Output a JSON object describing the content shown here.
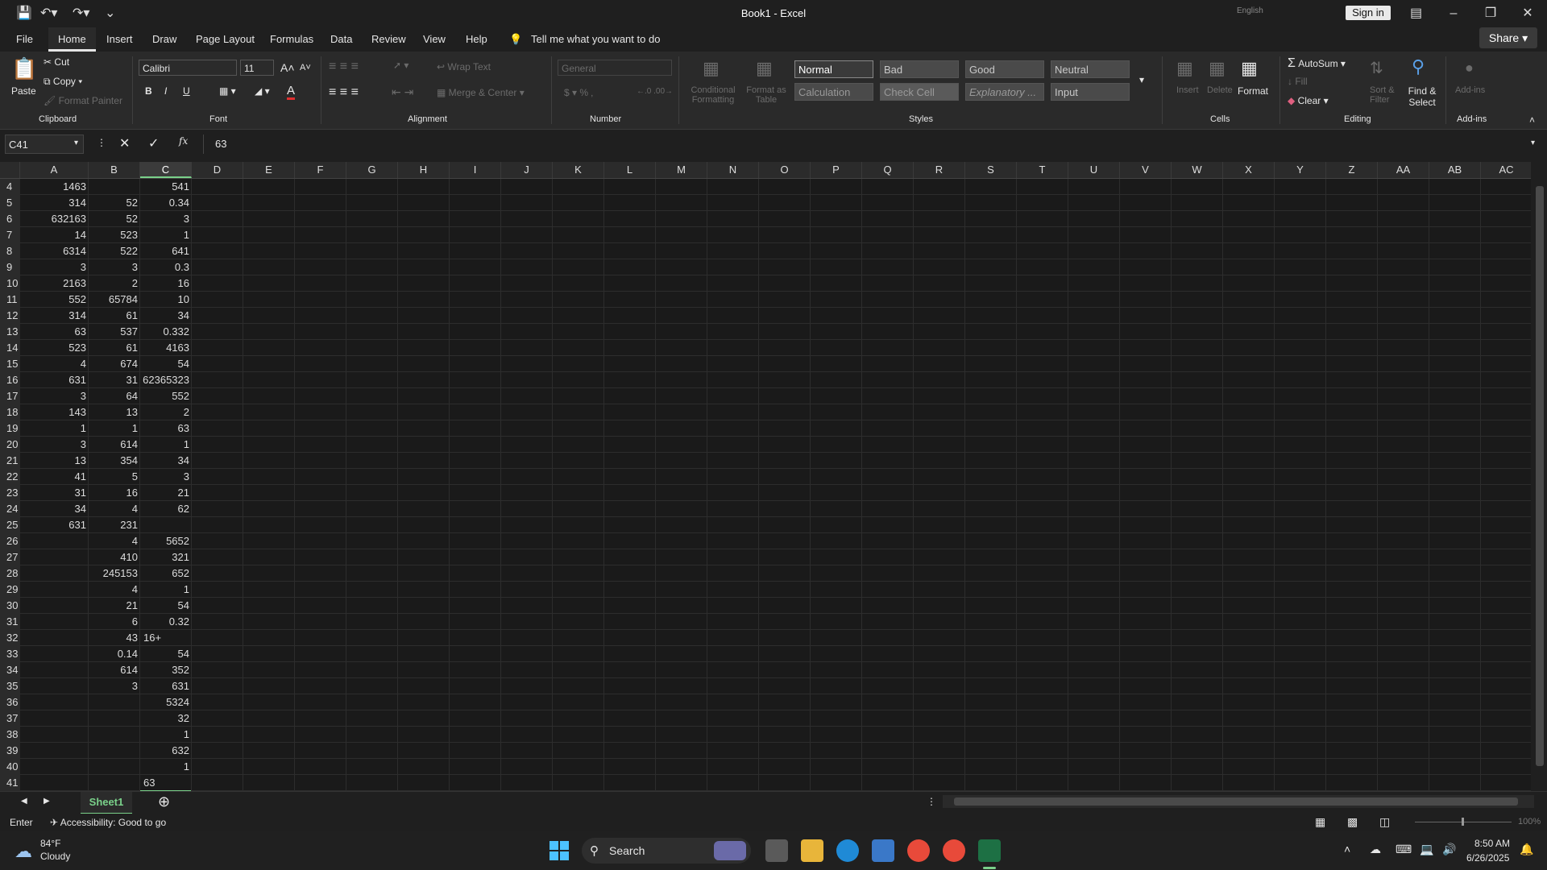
{
  "titlebar": {
    "title": "Book1  -  Excel",
    "signin": "Sign in",
    "language": "English"
  },
  "tabs": [
    "File",
    "Home",
    "Insert",
    "Draw",
    "Page Layout",
    "Formulas",
    "Data",
    "Review",
    "View",
    "Help"
  ],
  "tell_me": "Tell me what you want to do",
  "share": "Share",
  "ribbon": {
    "clipboard": {
      "paste": "Paste",
      "cut": "Cut",
      "copy": "Copy",
      "format_painter": "Format Painter",
      "label": "Clipboard"
    },
    "font": {
      "name": "Calibri",
      "size": "11",
      "bold": "B",
      "italic": "I",
      "underline": "U",
      "label": "Font"
    },
    "alignment": {
      "wrap": "Wrap Text",
      "merge": "Merge & Center",
      "label": "Alignment"
    },
    "number": {
      "format": "General",
      "label": "Number"
    },
    "styles": {
      "conditional": "Conditional Formatting",
      "format_as_table": "Format as Table",
      "cells": [
        "Normal",
        "Bad",
        "Good",
        "Neutral",
        "Calculation",
        "Check Cell",
        "Explanatory ...",
        "Input"
      ],
      "label": "Styles"
    },
    "cells": {
      "insert": "Insert",
      "delete": "Delete",
      "format": "Format",
      "label": "Cells"
    },
    "editing": {
      "autosum": "AutoSum",
      "fill": "Fill",
      "clear": "Clear",
      "sort": "Sort & Filter",
      "find": "Find & Select",
      "label": "Editing"
    },
    "addins": {
      "label": "Add-ins",
      "button": "Add-ins"
    }
  },
  "formula_bar": {
    "name_box": "C41",
    "value": "63"
  },
  "columns": [
    "A",
    "B",
    "C",
    "D",
    "E",
    "F",
    "G",
    "H",
    "I",
    "J",
    "K",
    "L",
    "M",
    "N",
    "O",
    "P",
    "Q",
    "R",
    "S",
    "T",
    "U",
    "V",
    "W",
    "X",
    "Y",
    "Z",
    "AA",
    "AB",
    "AC"
  ],
  "rows": [
    {
      "n": "4",
      "a": "1463",
      "b": "",
      "c": "541"
    },
    {
      "n": "5",
      "a": "314",
      "b": "52",
      "c": "0.34"
    },
    {
      "n": "6",
      "a": "632163",
      "b": "52",
      "c": "3"
    },
    {
      "n": "7",
      "a": "14",
      "b": "523",
      "c": "1"
    },
    {
      "n": "8",
      "a": "6314",
      "b": "522",
      "c": "641"
    },
    {
      "n": "9",
      "a": "3",
      "b": "3",
      "c": "0.3"
    },
    {
      "n": "10",
      "a": "2163",
      "b": "2",
      "c": "16"
    },
    {
      "n": "11",
      "a": "552",
      "b": "65784",
      "c": "10"
    },
    {
      "n": "12",
      "a": "314",
      "b": "61",
      "c": "34"
    },
    {
      "n": "13",
      "a": "63",
      "b": "537",
      "c": "0.332"
    },
    {
      "n": "14",
      "a": "523",
      "b": "61",
      "c": "4163"
    },
    {
      "n": "15",
      "a": "4",
      "b": "674",
      "c": "54"
    },
    {
      "n": "16",
      "a": "631",
      "b": "31",
      "c": "62365323"
    },
    {
      "n": "17",
      "a": "3",
      "b": "64",
      "c": "552"
    },
    {
      "n": "18",
      "a": "143",
      "b": "13",
      "c": "2"
    },
    {
      "n": "19",
      "a": "1",
      "b": "1",
      "c": "63"
    },
    {
      "n": "20",
      "a": "3",
      "b": "614",
      "c": "1"
    },
    {
      "n": "21",
      "a": "13",
      "b": "354",
      "c": "34"
    },
    {
      "n": "22",
      "a": "41",
      "b": "5",
      "c": "3"
    },
    {
      "n": "23",
      "a": "31",
      "b": "16",
      "c": "21"
    },
    {
      "n": "24",
      "a": "34",
      "b": "4",
      "c": "62"
    },
    {
      "n": "25",
      "a": "631",
      "b": "231",
      "c": ""
    },
    {
      "n": "26",
      "a": "",
      "b": "4",
      "c": "5652"
    },
    {
      "n": "27",
      "a": "",
      "b": "410",
      "c": "321"
    },
    {
      "n": "28",
      "a": "",
      "b": "245153",
      "c": "652"
    },
    {
      "n": "29",
      "a": "",
      "b": "4",
      "c": "1"
    },
    {
      "n": "30",
      "a": "",
      "b": "21",
      "c": "54"
    },
    {
      "n": "31",
      "a": "",
      "b": "6",
      "c": "0.32"
    },
    {
      "n": "32",
      "a": "",
      "b": "43",
      "c": "16+"
    },
    {
      "n": "33",
      "a": "",
      "b": "0.14",
      "c": "54"
    },
    {
      "n": "34",
      "a": "",
      "b": "614",
      "c": "352"
    },
    {
      "n": "35",
      "a": "",
      "b": "3",
      "c": "631"
    },
    {
      "n": "36",
      "a": "",
      "b": "",
      "c": "5324"
    },
    {
      "n": "37",
      "a": "",
      "b": "",
      "c": "32"
    },
    {
      "n": "38",
      "a": "",
      "b": "",
      "c": "1"
    },
    {
      "n": "39",
      "a": "",
      "b": "",
      "c": "632"
    },
    {
      "n": "40",
      "a": "",
      "b": "",
      "c": "1"
    },
    {
      "n": "41",
      "a": "",
      "b": "",
      "c": "63"
    }
  ],
  "sheet": {
    "tab": "Sheet1"
  },
  "status": {
    "mode": "Enter",
    "accessibility": "Accessibility: Good to go",
    "zoom": "100%"
  },
  "taskbar": {
    "temp": "84°F",
    "weather": "Cloudy",
    "search": "Search",
    "time": "8:50 AM",
    "date": "6/26/2025"
  }
}
